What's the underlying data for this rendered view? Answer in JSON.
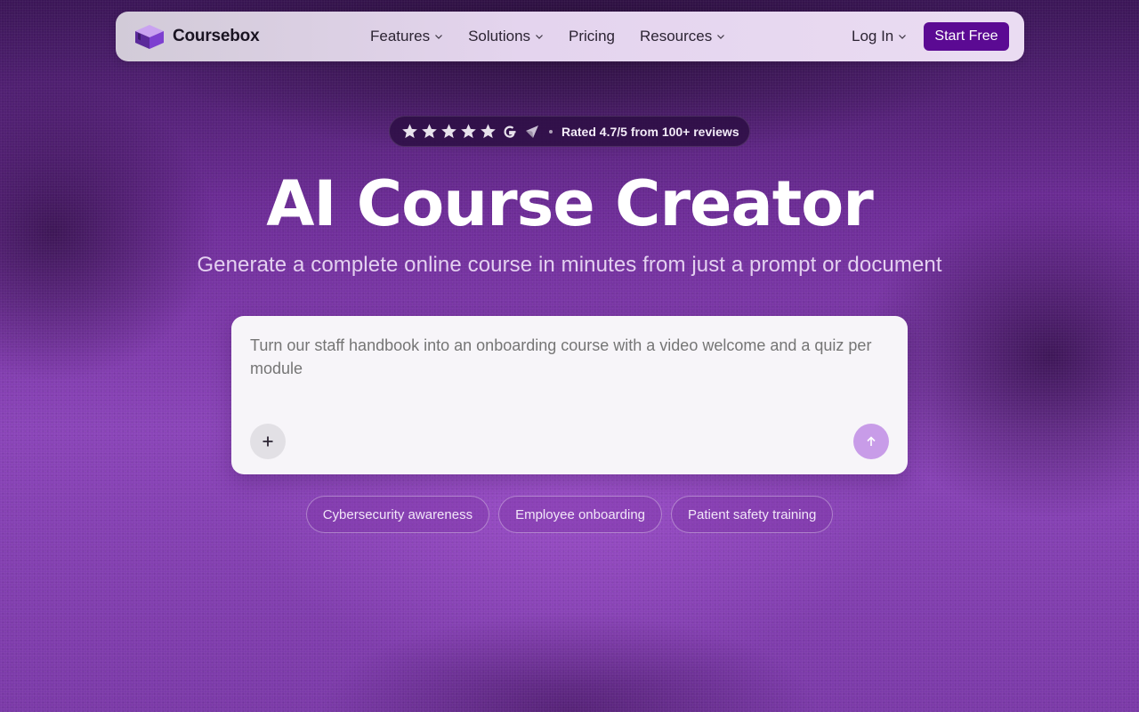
{
  "brand": {
    "name": "Coursebox"
  },
  "nav": {
    "items": [
      {
        "label": "Features",
        "has_dropdown": true
      },
      {
        "label": "Solutions",
        "has_dropdown": true
      },
      {
        "label": "Pricing",
        "has_dropdown": false
      },
      {
        "label": "Resources",
        "has_dropdown": true
      }
    ],
    "login_label": "Log In",
    "cta_label": "Start Free"
  },
  "rating": {
    "stars": 5,
    "icons": [
      "google-icon",
      "capterra-icon"
    ],
    "text": "Rated 4.7/5 from 100+ reviews"
  },
  "hero": {
    "title": "AI Course Creator",
    "subtitle": "Generate a complete online course in minutes from just a prompt or document"
  },
  "prompt": {
    "placeholder": "Turn our staff handbook into an onboarding course with a video welcome and a quiz per module",
    "add_icon": "plus-icon",
    "send_icon": "arrow-up-icon"
  },
  "suggestions": [
    {
      "label": "Cybersecurity awareness"
    },
    {
      "label": "Employee onboarding"
    },
    {
      "label": "Patient safety training"
    }
  ],
  "colors": {
    "accent": "#5b0a93",
    "send_button": "#c89ce8",
    "background": "#7b3aa8"
  }
}
